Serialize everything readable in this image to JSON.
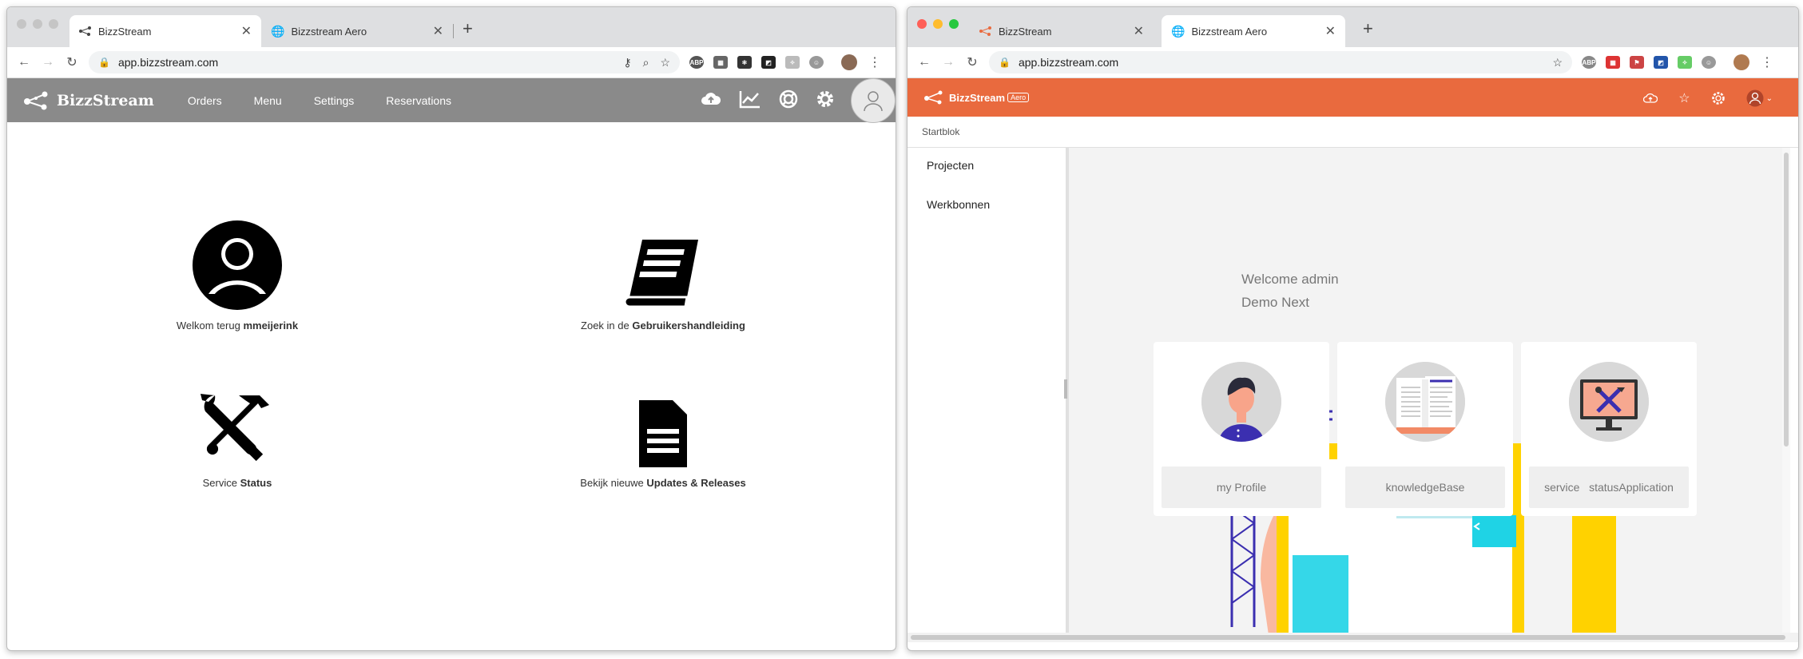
{
  "left_window": {
    "tabs": [
      {
        "label": "BizzStream",
        "active": true
      },
      {
        "label": "Bizzstream Aero",
        "active": false
      }
    ],
    "url": "app.bizzstream.com",
    "app": {
      "brand": "BizzStream",
      "menu": [
        "Orders",
        "Menu",
        "Settings",
        "Reservations"
      ],
      "icons": [
        "cloud-upload-icon",
        "chart-icon",
        "lifebuoy-icon",
        "gear-icon",
        "user-icon"
      ],
      "nav_color": "#8a8a8a"
    },
    "tiles": [
      {
        "prefix": "Welkom terug ",
        "strong": "mmeijerink"
      },
      {
        "prefix": "Zoek in de ",
        "strong": "Gebruikershandleiding"
      },
      {
        "prefix": "Service ",
        "strong": "Status"
      },
      {
        "prefix": "Bekijk nieuwe ",
        "strong": "Updates & Releases"
      }
    ]
  },
  "right_window": {
    "tabs": [
      {
        "label": "BizzStream",
        "active": false
      },
      {
        "label": "Bizzstream Aero",
        "active": true
      }
    ],
    "url": "app.bizzstream.com",
    "app": {
      "brand": "BizzStream",
      "badge": "Aero",
      "nav_color": "#e96a3e"
    },
    "breadcrumb": "Startblok",
    "sidebar": [
      "Projecten",
      "Werkbonnen"
    ],
    "welcome_line1": "Welcome admin",
    "welcome_line2": "Demo Next",
    "cards": [
      "my Profile",
      "knowledgeBase",
      "service   statusApplication"
    ]
  }
}
